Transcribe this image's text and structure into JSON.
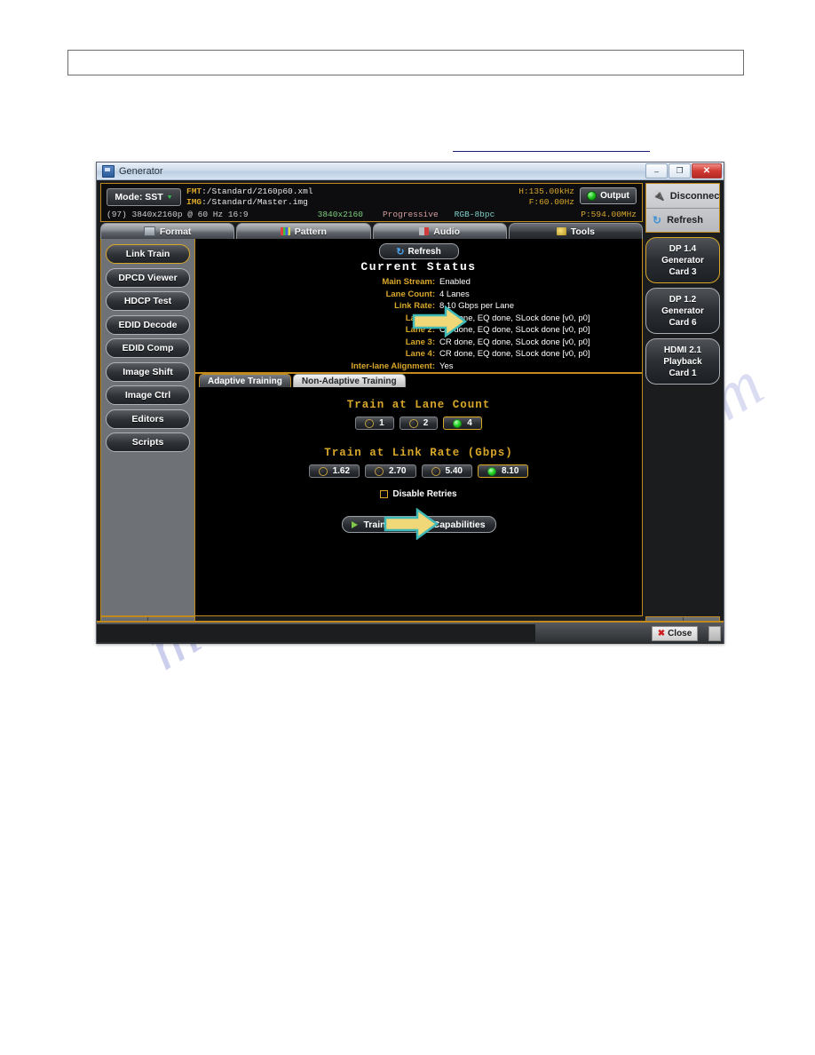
{
  "window": {
    "title": "Generator",
    "controls": {
      "minimize": "–",
      "maximize": "❐",
      "close": "✕"
    }
  },
  "header": {
    "mode_label": "Mode: SST",
    "mode_caret": "▼",
    "fmt_key": "FMT",
    "fmt_value": ":/Standard/2160p60.xml",
    "img_key": "IMG",
    "img_value": ":/Standard/Master.img",
    "h_freq": "H:135.00kHz",
    "v_freq": "F:60.00Hz",
    "pixel_clock": "P:594.00MHz",
    "output_label": "Output",
    "output_led": "green-led-icon",
    "timing_index": "(97)  3840x2160p @ 60 Hz 16:9",
    "resolution": "3840x2160",
    "scan_type": "Progressive",
    "color_format": "RGB-8bpc"
  },
  "tabs": [
    {
      "label": "Format",
      "icon": "monitor-icon",
      "active": false
    },
    {
      "label": "Pattern",
      "icon": "pattern-icon",
      "active": false
    },
    {
      "label": "Audio",
      "icon": "audio-icon",
      "active": false
    },
    {
      "label": "Tools",
      "icon": "tools-icon",
      "active": true
    }
  ],
  "left_rail": [
    {
      "label": "Link Train",
      "selected": true
    },
    {
      "label": "DPCD Viewer",
      "selected": false
    },
    {
      "label": "HDCP Test",
      "selected": false
    },
    {
      "label": "EDID Decode",
      "selected": false
    },
    {
      "label": "EDID Comp",
      "selected": false
    },
    {
      "label": "Image Shift",
      "selected": false
    },
    {
      "label": "Image Ctrl",
      "selected": false
    },
    {
      "label": "Editors",
      "selected": false
    },
    {
      "label": "Scripts",
      "selected": false
    }
  ],
  "content": {
    "refresh_label": "Refresh",
    "refresh_icon": "refresh-icon",
    "status_title": "Current Status",
    "status_rows": [
      {
        "key": "Main Stream:",
        "value": "Enabled"
      },
      {
        "key": "Lane Count:",
        "value": "4 Lanes"
      },
      {
        "key": "Link Rate:",
        "value": "8.10 Gbps per Lane"
      },
      {
        "key": "Lane 1:",
        "value": "CR done, EQ done, SLock done [v0, p0]"
      },
      {
        "key": "Lane 2:",
        "value": "CR done, EQ done, SLock done [v0, p0]"
      },
      {
        "key": "Lane 3:",
        "value": "CR done, EQ done, SLock done [v0, p0]"
      },
      {
        "key": "Lane 4:",
        "value": "CR done, EQ done, SLock done [v0, p0]"
      },
      {
        "key": "Inter-lane Alignment:",
        "value": "Yes"
      }
    ],
    "inner_tabs": [
      {
        "label": "Adaptive Training",
        "active": true
      },
      {
        "label": "Non-Adaptive Training",
        "active": false
      }
    ],
    "lane_count": {
      "title": "Train at Lane Count",
      "options": [
        {
          "label": "1",
          "selected": false
        },
        {
          "label": "2",
          "selected": false
        },
        {
          "label": "4",
          "selected": true
        }
      ]
    },
    "link_rate": {
      "title": "Train at Link Rate (Gbps)",
      "options": [
        {
          "label": "1.62",
          "selected": false
        },
        {
          "label": "2.70",
          "selected": false
        },
        {
          "label": "5.40",
          "selected": false
        },
        {
          "label": "8.10",
          "selected": true
        }
      ]
    },
    "disable_retries_label": "Disable Retries",
    "disable_retries_checked": false,
    "train_button_label": "Train Based on Capabilities"
  },
  "right_rail": {
    "actions": [
      {
        "label": "Disconnect",
        "icon": "plug-icon"
      },
      {
        "label": "Refresh",
        "icon": "refresh-icon"
      }
    ],
    "cards": [
      {
        "line1": "DP 1.4",
        "line2": "Generator",
        "line3": "Card 3",
        "selected": true
      },
      {
        "line1": "DP 1.2",
        "line2": "Generator",
        "line3": "Card 6",
        "selected": false
      },
      {
        "line1": "HDMI 2.1",
        "line2": "Playback",
        "line3": "Card 1",
        "selected": false
      }
    ]
  },
  "scroll": {
    "up": "∧",
    "down": "∨"
  },
  "statusbar": {
    "close_label": "Close",
    "close_icon": "close-x-icon"
  },
  "page": {
    "watermark": "manualslib.com"
  },
  "colors": {
    "gold": "#d8a72a",
    "frame_gold": "#c08a1e",
    "green_led": "#1fd01f",
    "arrow_fill": "#f0d778",
    "arrow_stroke": "#3fb8b8",
    "panel_bg": "#000000"
  }
}
